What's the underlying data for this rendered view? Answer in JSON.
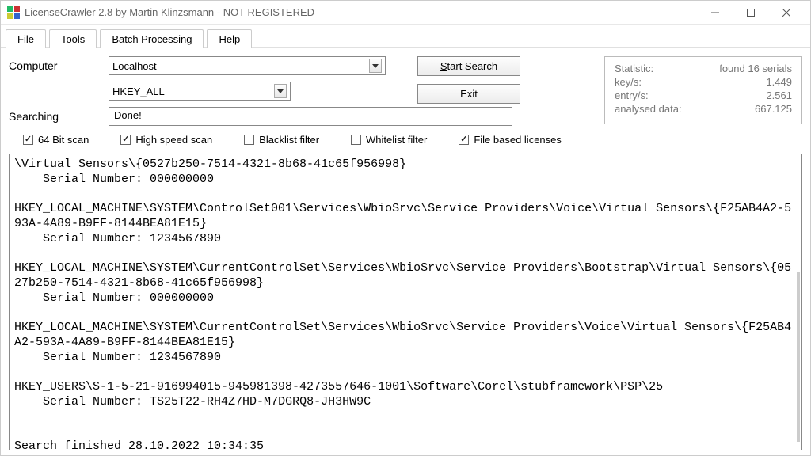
{
  "window": {
    "title": "LicenseCrawler 2.8 by Martin Klinzsmann - NOT REGISTERED"
  },
  "menu": {
    "file": "File",
    "tools": "Tools",
    "batch": "Batch Processing",
    "help": "Help"
  },
  "labels": {
    "computer": "Computer",
    "searching": "Searching"
  },
  "combos": {
    "computer": "Localhost",
    "hive": "HKEY_ALL"
  },
  "search_status": "Done!",
  "buttons": {
    "start_prefix": "S",
    "start_rest": "tart Search",
    "exit": "Exit"
  },
  "stats": {
    "title": "Statistic:",
    "found": "found 16 serials",
    "key_label": "key/s:",
    "key_val": "1.449",
    "entry_label": "entry/s:",
    "entry_val": "2.561",
    "analysed_label": "analysed data:",
    "analysed_val": "667.125"
  },
  "checks": {
    "bit64": "64 Bit scan",
    "highspeed": "High speed scan",
    "blacklist": "Blacklist filter",
    "whitelist": "Whitelist filter",
    "filebased": "File based licenses"
  },
  "results_text": "\\Virtual Sensors\\{0527b250-7514-4321-8b68-41c65f956998}\n    Serial Number: 000000000\n\nHKEY_LOCAL_MACHINE\\SYSTEM\\ControlSet001\\Services\\WbioSrvc\\Service Providers\\Voice\\Virtual Sensors\\{F25AB4A2-593A-4A89-B9FF-8144BEA81E15}\n    Serial Number: 1234567890\n\nHKEY_LOCAL_MACHINE\\SYSTEM\\CurrentControlSet\\Services\\WbioSrvc\\Service Providers\\Bootstrap\\Virtual Sensors\\{0527b250-7514-4321-8b68-41c65f956998}\n    Serial Number: 000000000\n\nHKEY_LOCAL_MACHINE\\SYSTEM\\CurrentControlSet\\Services\\WbioSrvc\\Service Providers\\Voice\\Virtual Sensors\\{F25AB4A2-593A-4A89-B9FF-8144BEA81E15}\n    Serial Number: 1234567890\n\nHKEY_USERS\\S-1-5-21-916994015-945981398-4273557646-1001\\Software\\Corel\\stubframework\\PSP\\25\n    Serial Number: TS25T22-RH4Z7HD-M7DGRQ8-JH3HW9C\n\n\nSearch finished 28.10.2022 10:34:35"
}
